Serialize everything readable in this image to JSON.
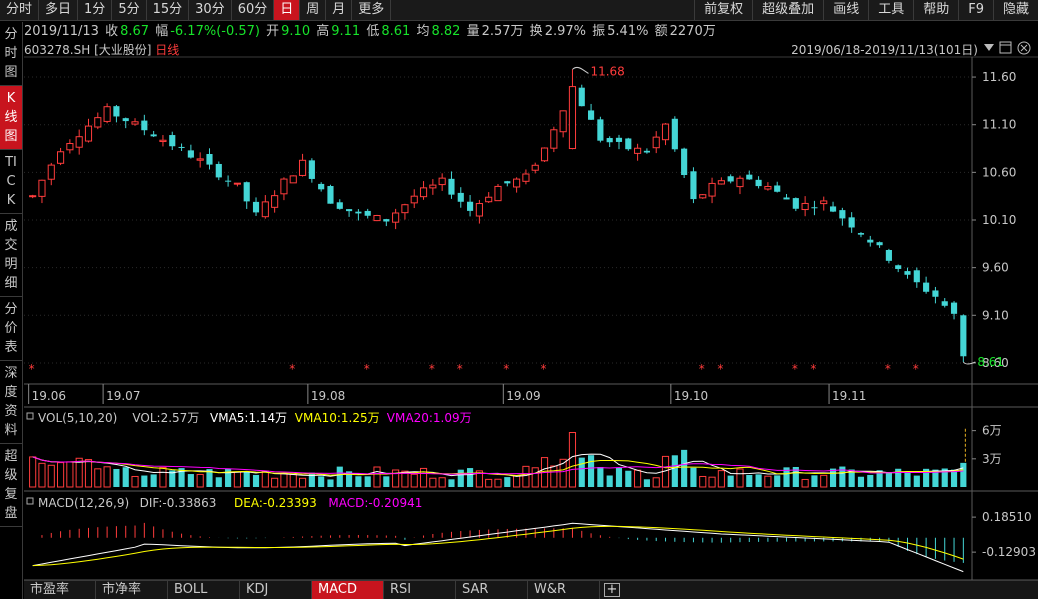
{
  "periods": [
    "分时",
    "多日",
    "1分",
    "5分",
    "15分",
    "30分",
    "60分",
    "日",
    "周",
    "月",
    "更多"
  ],
  "active_period": "日",
  "tools": [
    "前复权",
    "超级叠加",
    "画线",
    "工具",
    "帮助",
    "F9",
    "隐藏"
  ],
  "sidebar": [
    "分时图",
    "K线图",
    "TICK",
    "成交明细",
    "分价表",
    "深度资料",
    "超级复盘"
  ],
  "active_sidebar": "K线图",
  "info": {
    "date": "2019/11/13",
    "close_label": "收",
    "close": "8.67",
    "range_label": "幅",
    "range": "-6.17%(-0.57)",
    "open_label": "开",
    "open": "9.10",
    "high_label": "高",
    "high": "9.11",
    "low_label": "低",
    "low": "8.61",
    "avg_label": "均",
    "avg": "8.82",
    "vol_label": "量",
    "vol": "2.57万",
    "turn_label": "换",
    "turn": "2.97%",
    "amp_label": "振",
    "amp": "5.41%",
    "amt_label": "额",
    "amt": "2270万"
  },
  "stock": {
    "code": "603278.SH",
    "name": "[大业股份]",
    "period": "日线"
  },
  "date_range": "2019/06/18-2019/11/13(101日)",
  "vol_header": {
    "name": "VOL(5,10,20)",
    "vol": "VOL:2.57万",
    "vma5": "VMA5:1.14万",
    "vma10": "VMA10:1.25万",
    "vma20": "VMA20:1.09万"
  },
  "macd_header": {
    "name": "MACD(12,26,9)",
    "dif": "DIF:-0.33863",
    "dea": "DEA:-0.23393",
    "macd": "MACD:-0.20941"
  },
  "bottom_tabs": [
    "市盈率",
    "市净率",
    "BOLL",
    "KDJ",
    "MACD",
    "RSI",
    "SAR",
    "W&R"
  ],
  "active_bottom_tab": "MACD",
  "colors": {
    "up": "#ff3c3c",
    "down": "#44d6d6",
    "vma5": "#ffffff",
    "vma10": "#ffff00",
    "vma20": "#ff00ff",
    "accent": "#c8141e"
  },
  "chart_data": {
    "type": "candlestick",
    "price_axis": {
      "ticks": [
        11.6,
        11.1,
        10.6,
        10.1,
        9.6,
        9.1,
        8.6
      ],
      "ylim": [
        8.4,
        11.8
      ]
    },
    "x_ticks": [
      {
        "label": "19.06",
        "index": 0
      },
      {
        "label": "19.07",
        "index": 8
      },
      {
        "label": "19.08",
        "index": 30
      },
      {
        "label": "19.09",
        "index": 51
      },
      {
        "label": "19.10",
        "index": 69
      },
      {
        "label": "19.11",
        "index": 86
      }
    ],
    "max_label": "11.68",
    "min_label": "8.61",
    "star_indices": [
      0,
      28,
      36,
      43,
      46,
      51,
      55,
      72,
      74,
      82,
      84,
      92,
      95
    ],
    "vol_axis": {
      "ticks": [
        "6万",
        "3万"
      ],
      "tick_values": [
        6,
        3
      ],
      "ylim": [
        0,
        6.6
      ]
    },
    "macd_axis": {
      "ticks": [
        "0.18510",
        "-0.12903"
      ],
      "tick_values": [
        0.1851,
        -0.12903
      ],
      "ylim": [
        -0.37,
        0.24
      ]
    }
  }
}
